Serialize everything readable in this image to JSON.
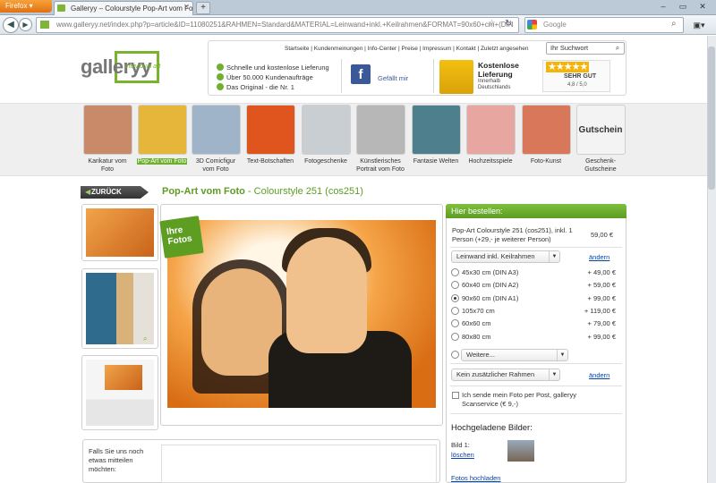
{
  "browser": {
    "app_button": "Firefox",
    "tab_title": "Galleryy – Colourstyle Pop-Art vom Foto...",
    "url": "www.galleryy.net/index.php?p=article&ID=11080251&RAHMEN=Standard&MATERIAL=Leinwand+inkl.+Keilrahmen&FORMAT=90x60+cm+(DIN",
    "search_placeholder": "Google"
  },
  "header": {
    "logo_text": "galleryy",
    "logo_sub": "individual art",
    "top_links": "Startseite | Kundenmeinungen | Info-Center | Preise | Impressum | Kontakt | Zuletzt angesehen",
    "search_placeholder": "Ihr Suchwort",
    "benefits": [
      "Schnelle und kostenlose Lieferung",
      "Über 50.000 Kundenaufträge",
      "Das Original - die Nr. 1"
    ],
    "facebook_label": "Gefällt mir",
    "delivery_title": "Kostenlose Lieferung",
    "delivery_sub1": "Innerhalb",
    "delivery_sub2": "Deutschlands",
    "rating_stars": "★★★★★",
    "rating_label": "SEHR GUT",
    "rating_value": "4,8 / 5,0"
  },
  "categories": [
    {
      "label1": "Karikatur vom",
      "label2": "Foto",
      "color": "#c98a6a"
    },
    {
      "label1": "Pop-Art vom Foto",
      "label2": "",
      "color": "#e6b63a"
    },
    {
      "label1": "3D Comicfigur",
      "label2": "vom Foto",
      "color": "#9fb4c8"
    },
    {
      "label1": "Text-Botschaften",
      "label2": "",
      "color": "#e0541d"
    },
    {
      "label1": "Fotogeschenke",
      "label2": "",
      "color": "#c9ced3"
    },
    {
      "label1": "Künstlerisches",
      "label2": "Portrait vom Foto",
      "color": "#b7b7b7"
    },
    {
      "label1": "Fantasie Welten",
      "label2": "",
      "color": "#4e7f8c"
    },
    {
      "label1": "Hochzeitsspiele",
      "label2": "",
      "color": "#e7a6a0"
    },
    {
      "label1": "Foto-Kunst",
      "label2": "",
      "color": "#d9775a"
    },
    {
      "label1": "Geschenk-",
      "label2": "Gutscheine",
      "color": "#f3f3f3"
    }
  ],
  "gutschein_text": "Gutschein",
  "product": {
    "back_label": "ZURÜCK",
    "title": "Pop-Art vom Foto",
    "subtitle": " - Colourstyle 251 (cos251)",
    "badge": "Ihre Fotos",
    "message_label": "Falls Sie uns noch etwas mitteilen möchten:"
  },
  "order": {
    "header": "Hier bestellen:",
    "product_line": "Pop-Art Colourstyle 251 (cos251), inkl. 1 Person (+29,- je weiterer Person)",
    "product_price": "59,00 €",
    "material_select": "Leinwand inkl. Keilrahmen",
    "change_label": "ändern",
    "sizes": [
      {
        "label": "45x30 cm (DIN A3)",
        "price": "+ 49,00 €",
        "selected": false
      },
      {
        "label": "60x40 cm (DIN A2)",
        "price": "+ 59,00 €",
        "selected": false
      },
      {
        "label": "90x60 cm (DIN A1)",
        "price": "+ 99,00 €",
        "selected": true
      },
      {
        "label": "105x70 cm",
        "price": "+ 119,00 €",
        "selected": false
      },
      {
        "label": "60x60 cm",
        "price": "+ 79,00 €",
        "selected": false
      },
      {
        "label": "80x80 cm",
        "price": "+ 99,00 €",
        "selected": false
      }
    ],
    "more_select": "Weitere...",
    "frame_select": "Kein zusätzlicher Rahmen",
    "scan_label": "Ich sende mein Foto per Post, galleryy Scanservice (€ 9,-)",
    "uploaded_title": "Hochgeladene Bilder:",
    "image_label": "Bild 1:",
    "delete_label": "löschen",
    "upload_link": "Fotos hochladen"
  }
}
